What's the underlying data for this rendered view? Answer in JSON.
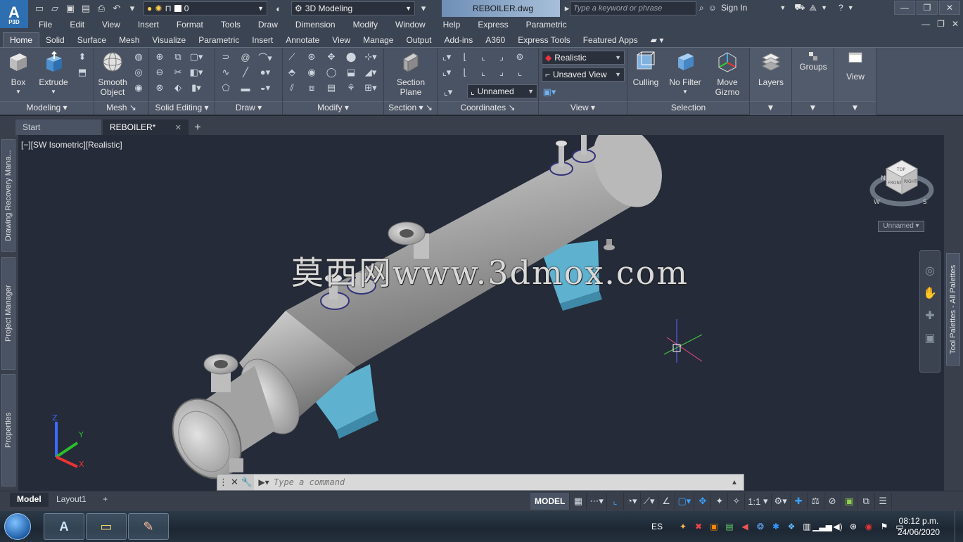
{
  "app": {
    "logo_text": "A",
    "logo_sub": "P3D",
    "doc_title": "REBOILER.dwg",
    "search_placeholder": "Type a keyword or phrase",
    "sign_in": "Sign In",
    "layer_value": "0",
    "workspace": "3D Modeling"
  },
  "menu": [
    "File",
    "Edit",
    "View",
    "Insert",
    "Format",
    "Tools",
    "Draw",
    "Dimension",
    "Modify",
    "Window",
    "Help",
    "Express",
    "Parametric"
  ],
  "ribbon_tabs": [
    "Home",
    "Solid",
    "Surface",
    "Mesh",
    "Visualize",
    "Parametric",
    "Insert",
    "Annotate",
    "View",
    "Manage",
    "Output",
    "Add-ins",
    "A360",
    "Express Tools",
    "Featured Apps"
  ],
  "ribbon": {
    "box": "Box",
    "extrude": "Extrude",
    "smooth_object": [
      "Smooth",
      "Object"
    ],
    "section_plane": [
      "Section",
      "Plane"
    ],
    "visual_style": "Realistic",
    "saved_view": "Unsaved View",
    "ucs_name": "Unnamed",
    "culling": "Culling",
    "no_filter": "No Filter",
    "move_gizmo": [
      "Move",
      "Gizmo"
    ],
    "layers": "Layers",
    "groups": "Groups",
    "view": "View",
    "panels": {
      "modeling": "Modeling",
      "mesh": "Mesh",
      "solid_editing": "Solid Editing",
      "draw": "Draw",
      "modify": "Modify",
      "section": "Section",
      "coordinates": "Coordinates",
      "view": "View",
      "selection": "Selection"
    }
  },
  "file_tabs": [
    {
      "label": "Start"
    },
    {
      "label": "REBOILER*"
    }
  ],
  "side_left": [
    "Drawing Recovery Mana...",
    "Project Manager",
    "Properties"
  ],
  "side_right": "Tool Palettes - All Palettes",
  "viewport": {
    "label": "[−][SW Isometric][Realistic]",
    "watermark": "莫西网www.3dmox.com",
    "viewcube_ucs": "Unnamed",
    "viewcube_faces": {
      "top": "TOP",
      "front": "FRONT",
      "right": "RIGHT"
    },
    "compass": {
      "n": "N",
      "w": "W",
      "s": "S"
    },
    "ucs": {
      "x": "X",
      "y": "Y",
      "z": "Z"
    }
  },
  "command": {
    "placeholder": "Type a command"
  },
  "layout_tabs": [
    "Model",
    "Layout1"
  ],
  "status": {
    "model": "MODEL",
    "scale": "1:1"
  },
  "taskbar": {
    "lang": "ES",
    "time": "08:12 p.m.",
    "date": "24/06/2020"
  },
  "colors": {
    "accent": "#2d6fb0",
    "viewport_bg": "#252b38",
    "ribbon_bg": "#4a5363",
    "vessel": "#a9a9a9",
    "supports": "#5fb2cf"
  }
}
